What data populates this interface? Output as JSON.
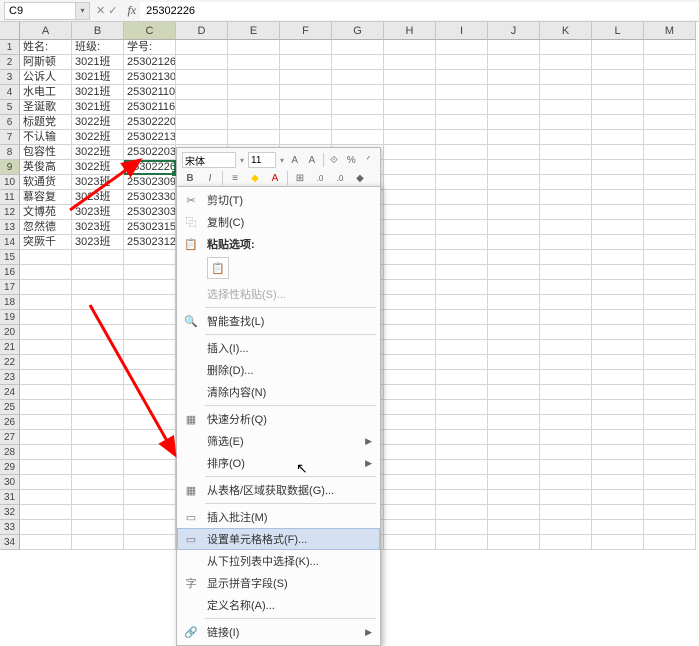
{
  "namebox": {
    "ref": "C9"
  },
  "formula": {
    "value": "25302226"
  },
  "columns": [
    "A",
    "B",
    "C",
    "D",
    "E",
    "F",
    "G",
    "H",
    "I",
    "J",
    "K",
    "L",
    "M"
  ],
  "selected_col_idx": 2,
  "selected_row_idx": 8,
  "rows": [
    {
      "n": 1,
      "cells": [
        "姓名:",
        "班级:",
        "学号:"
      ]
    },
    {
      "n": 2,
      "cells": [
        "阿斯顿",
        "3021班",
        "25302126"
      ]
    },
    {
      "n": 3,
      "cells": [
        "公诉人",
        "3021班",
        "25302130"
      ]
    },
    {
      "n": 4,
      "cells": [
        "水电工",
        "3021班",
        "25302110"
      ]
    },
    {
      "n": 5,
      "cells": [
        "圣诞歌",
        "3021班",
        "25302116"
      ]
    },
    {
      "n": 6,
      "cells": [
        "标题党",
        "3022班",
        "25302220"
      ]
    },
    {
      "n": 7,
      "cells": [
        "不认输",
        "3022班",
        "25302213"
      ]
    },
    {
      "n": 8,
      "cells": [
        "包容性",
        "3022班",
        "25302203"
      ]
    },
    {
      "n": 9,
      "cells": [
        "英俊高",
        "3022班",
        "25302226"
      ]
    },
    {
      "n": 10,
      "cells": [
        "软通货",
        "3023班",
        "25302309"
      ]
    },
    {
      "n": 11,
      "cells": [
        "慕容复",
        "3023班",
        "25302330"
      ]
    },
    {
      "n": 12,
      "cells": [
        "文博苑",
        "3023班",
        "25302303"
      ]
    },
    {
      "n": 13,
      "cells": [
        "忽然德",
        "3023班",
        "25302315"
      ]
    },
    {
      "n": 14,
      "cells": [
        "突厥千",
        "3023班",
        "25302312"
      ]
    }
  ],
  "empty_rows": [
    15,
    16,
    17,
    18,
    19,
    20,
    21,
    22,
    23,
    24,
    25,
    26,
    27,
    28,
    29,
    30,
    31,
    32,
    33,
    34
  ],
  "mini_toolbar": {
    "font": "宋体",
    "size": "11",
    "btns": [
      "A⁺",
      "A⁻",
      "⋯",
      "%",
      "ᐟ"
    ],
    "row2": [
      "B",
      "I",
      "≡",
      "◆",
      "A",
      "⊞",
      "⁰⁰",
      "⁰⁰",
      "◆"
    ]
  },
  "context_menu": {
    "cut": "剪切(T)",
    "copy": "复制(C)",
    "paste_header": "粘贴选项:",
    "paste_special": "选择性粘贴(S)...",
    "smart_lookup": "智能查找(L)",
    "insert": "插入(I)...",
    "delete": "删除(D)...",
    "clear": "清除内容(N)",
    "quick_analysis": "快速分析(Q)",
    "filter": "筛选(E)",
    "sort": "排序(O)",
    "get_data": "从表格/区域获取数据(G)...",
    "insert_comment": "插入批注(M)",
    "format_cells": "设置单元格格式(F)...",
    "pick_list": "从下拉列表中选择(K)...",
    "show_pinyin": "显示拼音字段(S)",
    "define_name": "定义名称(A)...",
    "link": "链接(I)"
  },
  "icons": {
    "cut": "✂",
    "copy": "⿻",
    "smart": "🔍",
    "qa": "▦",
    "table": "▦",
    "comment": "▭",
    "format": "▭",
    "pinyin": "字",
    "link": "🔗",
    "paste": "📋"
  }
}
